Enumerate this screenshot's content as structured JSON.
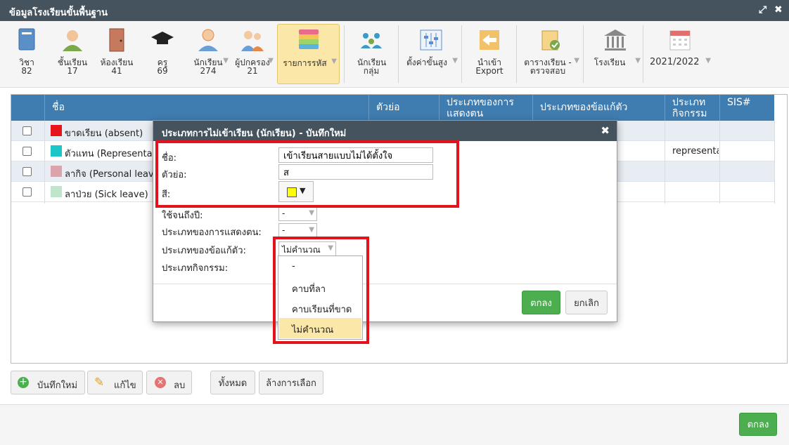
{
  "window": {
    "title": "ข้อมูลโรงเรียนขั้นพื้นฐาน",
    "expand_icon": "expand-icon",
    "close_icon": "close-icon"
  },
  "toolbar": [
    {
      "label": "วิชา",
      "count": "82",
      "icon": "book-icon",
      "color": "#4f89c6"
    },
    {
      "label": "ชั้นเรียน",
      "count": "17",
      "icon": "class-icon",
      "color": "#6a9a3c"
    },
    {
      "label": "ห้องเรียน",
      "count": "41",
      "icon": "door-icon",
      "color": "#b5654a"
    },
    {
      "label": "ครู",
      "count": "69",
      "icon": "graduation-cap-icon",
      "color": "#222222"
    },
    {
      "label": "นักเรียน",
      "count": "274",
      "icon": "student-icon",
      "color": "#e08a4c"
    },
    {
      "label": "ผู้ปกครอง",
      "count": "21",
      "icon": "parents-icon",
      "color": "#5b8ed0"
    },
    {
      "label": "รายการรหัส",
      "count": "",
      "icon": "layers-icon",
      "color": "#e05b7d"
    },
    {
      "label": "นักเรียน กลุ่ม",
      "count": "",
      "icon": "group-icon",
      "color": "#3c9ac9"
    },
    {
      "label": "ตั้งค่าขั้นสูง",
      "count": "",
      "icon": "sliders-icon",
      "color": "#5b8ed0"
    },
    {
      "label": "นำเข้า Export",
      "count": "",
      "icon": "import-icon",
      "color": "#e0a040"
    },
    {
      "label": "ตารางเรียน - ตรวจสอบ",
      "count": "",
      "icon": "clipboard-check-icon",
      "color": "#e0a040"
    },
    {
      "label": "โรงเรียน",
      "count": "",
      "icon": "school-building-icon",
      "color": "#777777"
    },
    {
      "label": "2021/2022",
      "count": "",
      "icon": "calendar-icon",
      "color": "#e07070"
    }
  ],
  "grid": {
    "headers": [
      "ชื่อ",
      "ตัวย่อ",
      "ประเภทของการ แสดงตน",
      "ประเภทของข้อแก้ตัว",
      "ประเภท กิจกรรม",
      "SIS#"
    ],
    "rows": [
      {
        "name": "ขาดเรียน (absent)",
        "color": "#e8141c",
        "activity": ""
      },
      {
        "name": "ตัวแทน (Representation)",
        "color": "#1ec7c7",
        "activity": "representat"
      },
      {
        "name": "ลากิจ (Personal leave)",
        "color": "#dda3ac",
        "activity": ""
      },
      {
        "name": "ลาป่วย (Sick leave)",
        "color": "#bfe6cd",
        "activity": ""
      }
    ]
  },
  "buttons": {
    "add": "บันทึกใหม่",
    "edit": "แก้ไข",
    "delete": "ลบ",
    "all": "ทั้งหมด",
    "clear": "ล้างการเลือก",
    "ok": "ตกลง"
  },
  "dialog": {
    "title": "ประเภทการไม่เข้าเรียน (นักเรียน) - บันทึกใหม่",
    "fields": {
      "name_label": "ชื่อ:",
      "name_value": "เข้าเรียนสายแบบไม่ได้ตั้งใจ",
      "abbr_label": "ตัวย่อ:",
      "abbr_value": "ส",
      "color_label": "สี:",
      "color_value": "#ffff00",
      "until_label": "ใช้จนถึงปี:",
      "until_value": "-",
      "presence_label": "ประเภทของการแสดงตน:",
      "presence_value": "-",
      "excuse_label": "ประเภทของข้อแก้ตัว:",
      "excuse_value": "ไม่คำนวณ",
      "activity_label": "ประเภทกิจกรรม:"
    },
    "dropdown_options": [
      "-",
      "คาบที่ลา",
      "คาบเรียนที่ขาด",
      "ไม่คำนวณ"
    ],
    "ok": "ตกลง",
    "cancel": "ยกเลิก"
  }
}
